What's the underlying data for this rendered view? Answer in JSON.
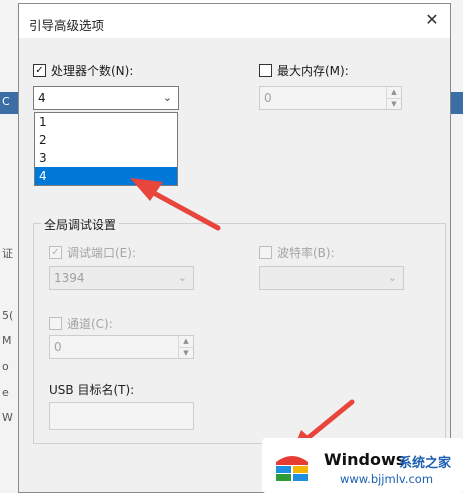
{
  "background": {
    "fragments": [
      "C",
      "证",
      "5(",
      "M",
      "o",
      "e",
      "W"
    ]
  },
  "dialog": {
    "title": "引导高级选项",
    "close_glyph": "✕",
    "processor_count": {
      "label": "处理器个数(N):",
      "checked": true,
      "check_glyph": "✓",
      "value": "4",
      "options": [
        "1",
        "2",
        "3",
        "4"
      ],
      "selected_option": "4"
    },
    "max_memory": {
      "label": "最大内存(M):",
      "checked": false,
      "value": "0"
    },
    "debug_group": {
      "title": "全局调试设置",
      "debug_port": {
        "label": "调试端口(E):",
        "checked": true,
        "check_glyph": "✓",
        "value": "1394"
      },
      "baud_rate": {
        "label": "波特率(B):",
        "checked": false,
        "value": ""
      },
      "channel": {
        "label": "通道(C):",
        "checked": false,
        "value": "0"
      },
      "usb_target": {
        "label": "USB 目标名(T):",
        "value": ""
      }
    }
  },
  "watermark": {
    "brand": "Windows",
    "cn": "系统之家",
    "url": "www.bjjmlv.com"
  },
  "colors": {
    "selection": "#0078d7",
    "annotation_arrow": "#e8453c",
    "watermark_text": "#1c5fb3"
  }
}
